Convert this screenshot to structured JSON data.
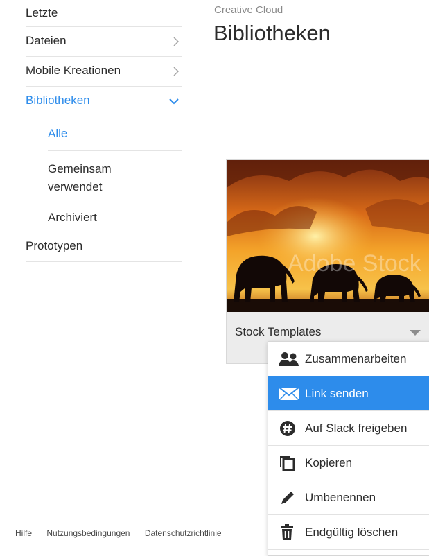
{
  "sidebar": {
    "items": [
      {
        "label": "Letzte"
      },
      {
        "label": "Dateien"
      },
      {
        "label": "Mobile Kreationen"
      },
      {
        "label": "Bibliotheken"
      }
    ],
    "sub_items": [
      {
        "label": "Alle"
      },
      {
        "label": "Gemeinsam verwendet"
      },
      {
        "label": "Archiviert"
      }
    ],
    "prototypes": {
      "label": "Prototypen"
    },
    "icons": {
      "chevron_right": "chevron-right-icon",
      "chevron_down": "chevron-down-icon"
    }
  },
  "header": {
    "breadcrumb": "Creative Cloud",
    "title": "Bibliotheken"
  },
  "library_card": {
    "name": "Stock Templates",
    "watermark": "Adobe Stock",
    "thumbnail": "sunset-elephants-image"
  },
  "context_menu": {
    "items": [
      {
        "label": "Zusammenarbeiten",
        "icon": "people-icon"
      },
      {
        "label": "Link senden",
        "icon": "envelope-icon"
      },
      {
        "label": "Auf Slack freigeben",
        "icon": "slack-icon"
      },
      {
        "label": "Kopieren",
        "icon": "copy-icon"
      },
      {
        "label": "Umbenennen",
        "icon": "pencil-icon"
      },
      {
        "label": "Endgültig löschen",
        "icon": "trash-icon"
      }
    ]
  },
  "footer": {
    "links": [
      {
        "label": "Hilfe"
      },
      {
        "label": "Nutzungsbedingungen"
      },
      {
        "label": "Datenschutzrichtlinie"
      }
    ]
  },
  "colors": {
    "accent": "#2d8ceb",
    "text": "#2c2c2c",
    "muted": "#8a8a8a",
    "divider": "#e4e4e4"
  }
}
